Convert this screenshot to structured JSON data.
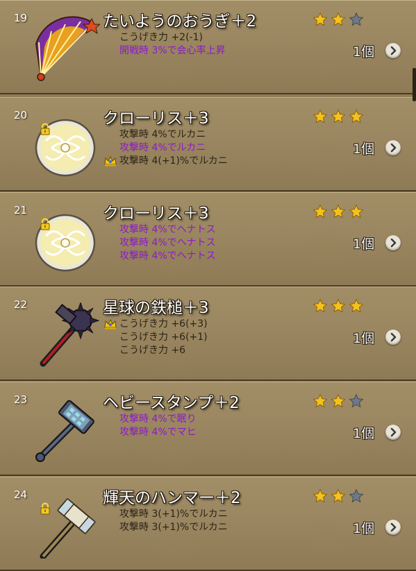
{
  "items": [
    {
      "number": "19",
      "name": "たいようのおうぎ＋2",
      "locked": false,
      "stars": 2,
      "icon": "sun-fan-icon",
      "stats": [
        {
          "text": "こうげき力 +2(-1)",
          "style": "plain",
          "crown": false
        },
        {
          "text": "開戦時 3%で会心率上昇",
          "style": "purple",
          "crown": false
        }
      ],
      "count": "1個"
    },
    {
      "number": "20",
      "name": "クローリス＋3",
      "locked": true,
      "stars": 3,
      "icon": "chloris-shield-icon",
      "stats": [
        {
          "text": "攻撃時 4%でルカニ",
          "style": "plain",
          "crown": false
        },
        {
          "text": "攻撃時 4%でルカニ",
          "style": "purple",
          "crown": false
        },
        {
          "text": "攻撃時 4(+1)%でルカニ",
          "style": "plain",
          "crown": true
        }
      ],
      "count": "1個"
    },
    {
      "number": "21",
      "name": "クローリス＋3",
      "locked": true,
      "stars": 3,
      "icon": "chloris-shield-icon",
      "stats": [
        {
          "text": "攻撃時 4%でヘナトス",
          "style": "purple",
          "crown": false
        },
        {
          "text": "攻撃時 4%でヘナトス",
          "style": "purple",
          "crown": false
        },
        {
          "text": "攻撃時 4%でヘナトス",
          "style": "purple",
          "crown": false
        }
      ],
      "count": "1個"
    },
    {
      "number": "22",
      "name": "星球の鉄槌＋3",
      "locked": false,
      "stars": 3,
      "icon": "morning-star-hammer-icon",
      "stats": [
        {
          "text": "こうげき力 +6(+3)",
          "style": "plain",
          "crown": true
        },
        {
          "text": "こうげき力 +6(+1)",
          "style": "plain",
          "crown": false
        },
        {
          "text": "こうげき力 +6",
          "style": "plain",
          "crown": false
        }
      ],
      "count": "1個"
    },
    {
      "number": "23",
      "name": "ヘビースタンプ＋2",
      "locked": false,
      "stars": 2,
      "icon": "heavy-stamp-hammer-icon",
      "stats": [
        {
          "text": "攻撃時 4%で眠り",
          "style": "purple",
          "crown": false
        },
        {
          "text": "攻撃時 4%でマヒ",
          "style": "purple",
          "crown": false
        }
      ],
      "count": "1個"
    },
    {
      "number": "24",
      "name": "輝天のハンマー＋2",
      "locked": true,
      "stars": 2,
      "icon": "radiant-hammer-icon",
      "stats": [
        {
          "text": "攻撃時 3(+1)%でルカニ",
          "style": "plain",
          "crown": false
        },
        {
          "text": "攻撃時 3(+1)%でルカニ",
          "style": "plain",
          "crown": false
        }
      ],
      "count": "1個"
    }
  ],
  "max_stars": 3,
  "colors": {
    "star_filled": "#f4c21c",
    "star_empty": "#6f7888",
    "purple_text": "#8d1ac9",
    "plain_text": "#2b2418"
  }
}
